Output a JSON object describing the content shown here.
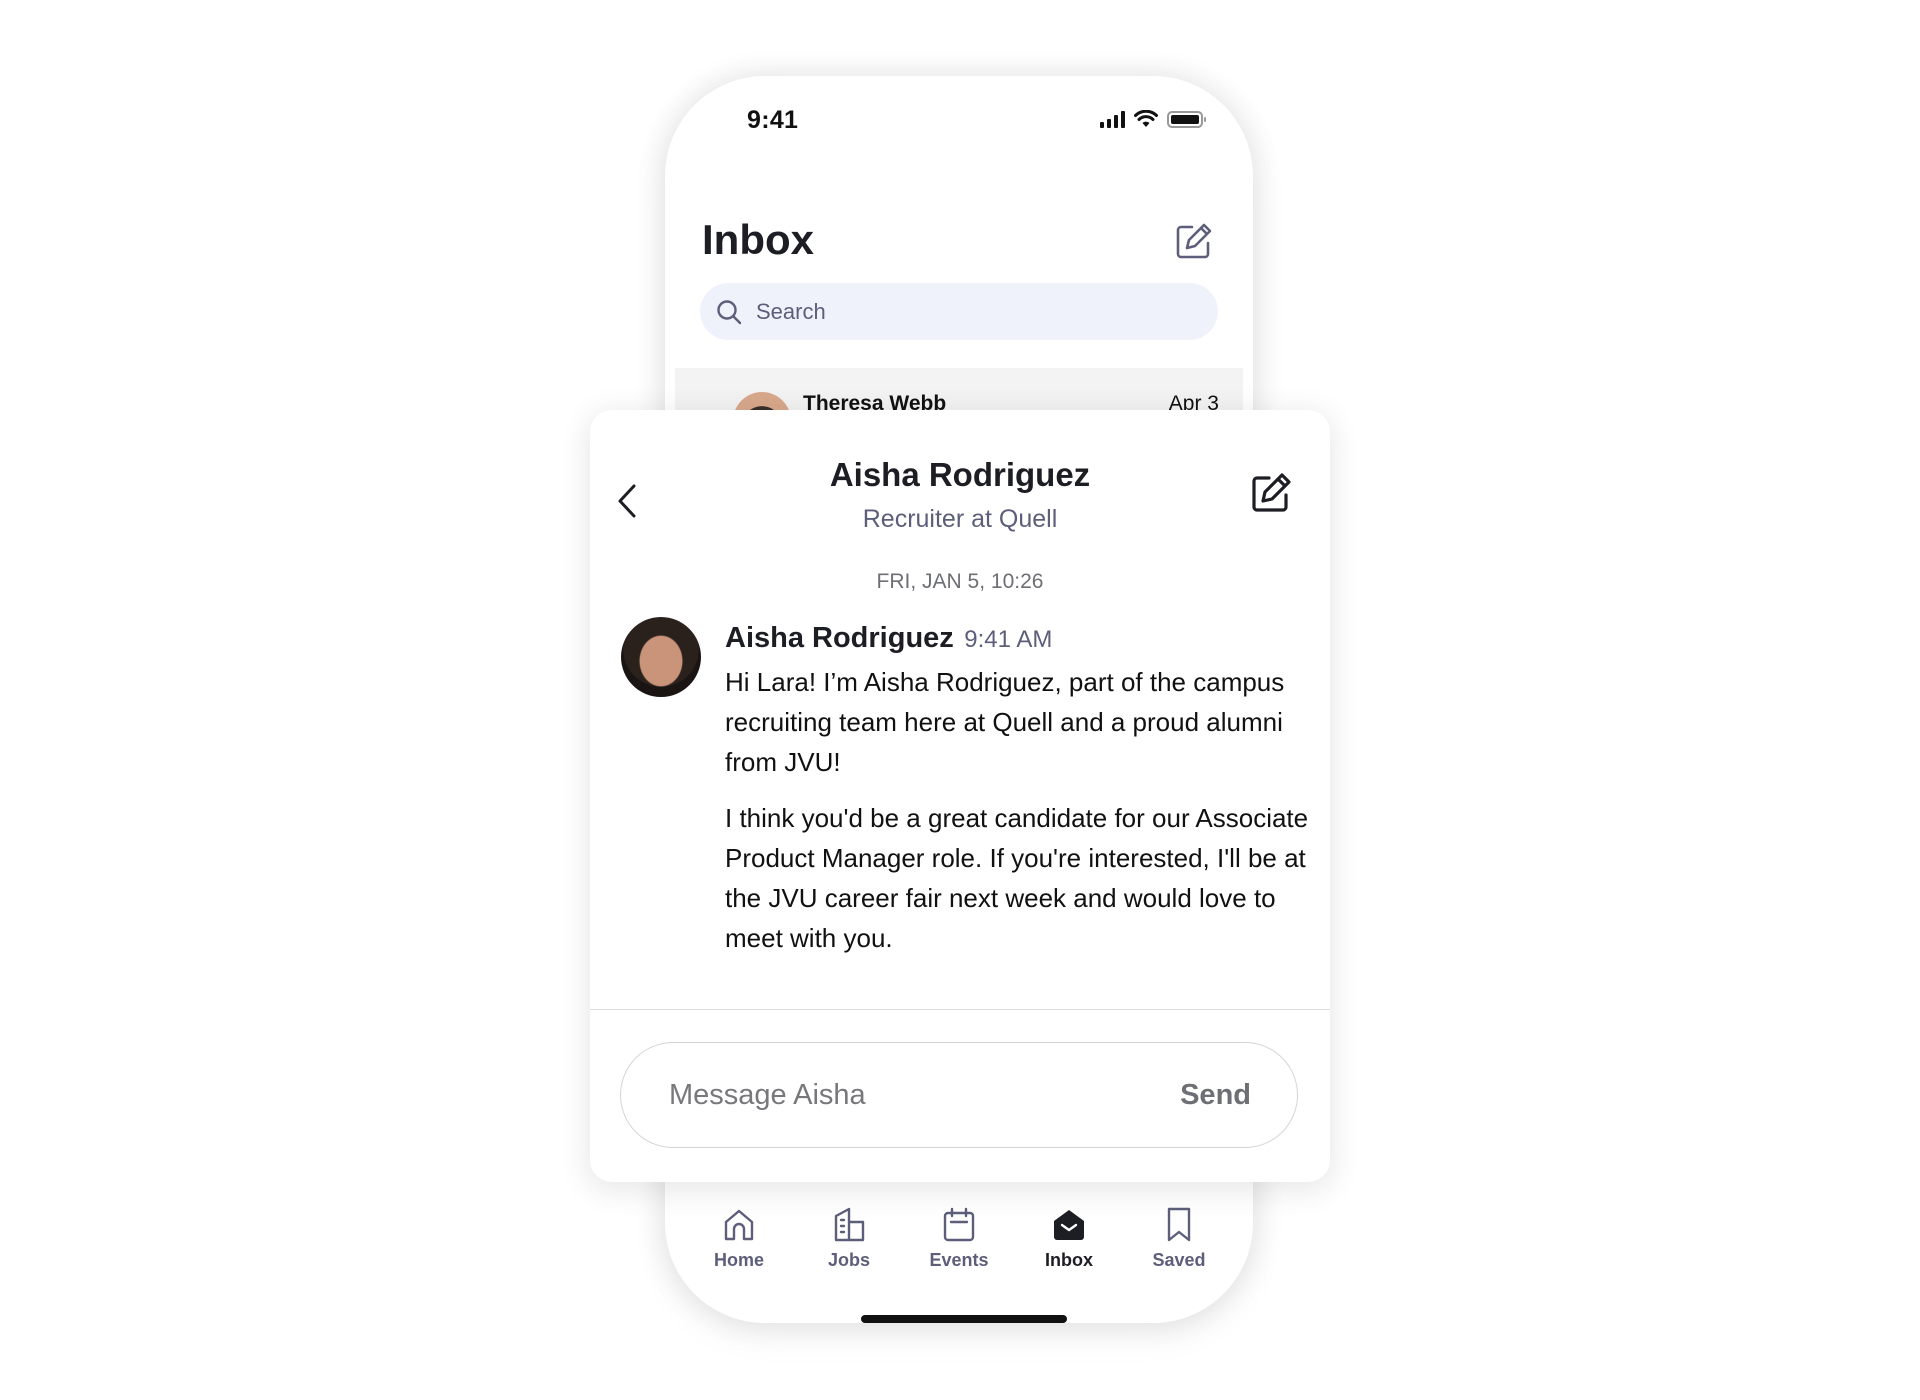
{
  "status_bar": {
    "time": "9:41"
  },
  "inbox": {
    "title": "Inbox",
    "search_placeholder": "Search",
    "conversations": [
      {
        "name": "Theresa Webb",
        "date": "Apr 3",
        "unread": true
      }
    ]
  },
  "tabbar": {
    "items": [
      {
        "label": "Home",
        "icon": "home-icon",
        "active": false
      },
      {
        "label": "Jobs",
        "icon": "building-icon",
        "active": false
      },
      {
        "label": "Events",
        "icon": "calendar-icon",
        "active": false
      },
      {
        "label": "Inbox",
        "icon": "envelope-open-icon",
        "active": true
      },
      {
        "label": "Saved",
        "icon": "bookmark-icon",
        "active": false
      }
    ]
  },
  "conversation": {
    "contact_name": "Aisha Rodriguez",
    "contact_subtitle": "Recruiter at Quell",
    "date_separator": "FRI, JAN 5, 10:26",
    "messages": [
      {
        "sender": "Aisha Rodriguez",
        "time": "9:41 AM",
        "paragraphs": [
          "Hi Lara! I’m Aisha Rodriguez, part of the campus recruiting team here at Quell and a proud alumni from JVU!",
          "I think you'd be a great candidate for our Associate Product Manager role. If you're interested, I'll be at the JVU career fair next week and would love to meet with you."
        ]
      }
    ],
    "composer_placeholder": "Message Aisha",
    "composer_value": "",
    "send_label": "Send"
  },
  "colors": {
    "primary_text": "#1d1d24",
    "secondary_text": "#5d5f7a",
    "search_bg": "#eff2fb",
    "muted": "#6e6f75"
  }
}
